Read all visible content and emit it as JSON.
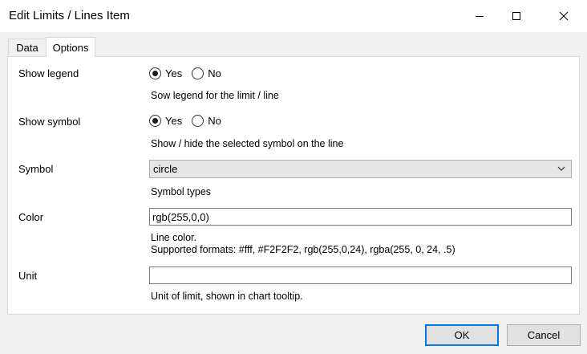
{
  "window": {
    "title": "Edit Limits / Lines Item"
  },
  "tabs": [
    {
      "label": "Data",
      "active": false
    },
    {
      "label": "Options",
      "active": true
    }
  ],
  "fields": {
    "show_legend": {
      "label": "Show legend",
      "options": [
        "Yes",
        "No"
      ],
      "selected": "Yes",
      "help": "Sow legend for the limit / line"
    },
    "show_symbol": {
      "label": "Show symbol",
      "options": [
        "Yes",
        "No"
      ],
      "selected": "Yes",
      "help": "Show / hide the selected symbol on the line"
    },
    "symbol": {
      "label": "Symbol",
      "value": "circle",
      "help": "Symbol types"
    },
    "color": {
      "label": "Color",
      "value": "rgb(255,0,0)",
      "help_line1": "Line color.",
      "help_line2": "Supported formats: #fff, #F2F2F2, rgb(255,0,24), rgba(255, 0, 24, .5)"
    },
    "unit": {
      "label": "Unit",
      "value": "",
      "help": "Unit of limit, shown in chart tooltip."
    }
  },
  "buttons": {
    "ok": "OK",
    "cancel": "Cancel"
  },
  "colors": {
    "accent": "#0078d7",
    "window_bg": "#f0f0f0",
    "panel_bg": "#ffffff"
  }
}
